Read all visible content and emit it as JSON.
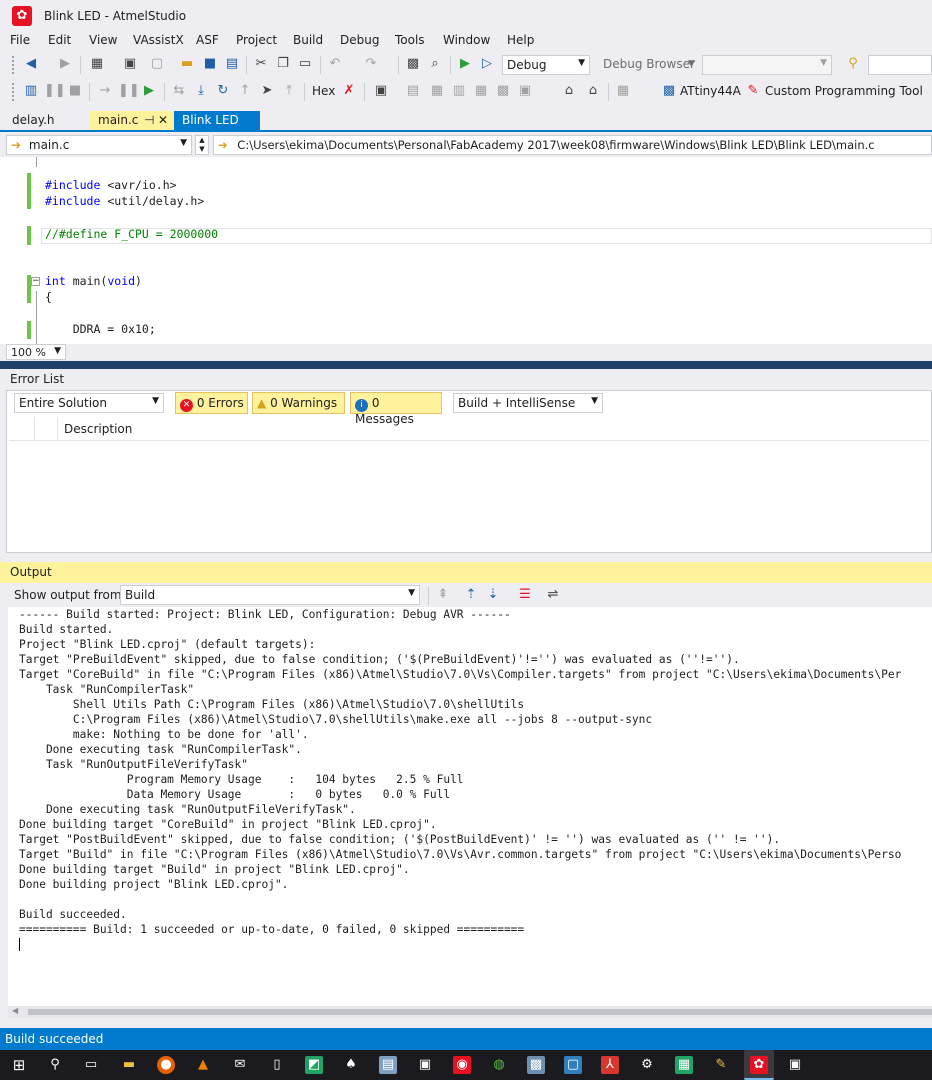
{
  "window": {
    "title": "Blink LED - AtmelStudio"
  },
  "menu": [
    "File",
    "Edit",
    "View",
    "VAssistX",
    "ASF",
    "Project",
    "Build",
    "Debug",
    "Tools",
    "Window",
    "Help"
  ],
  "toolbar1": {
    "config": "Debug",
    "debug_browser": "Debug Browser"
  },
  "toolbar2": {
    "hex": "Hex",
    "device": "ATtiny44A",
    "tool": "Custom Programming Tool"
  },
  "tabs": [
    {
      "label": "delay.h"
    },
    {
      "label": "main.c",
      "pin": "⊣",
      "close": "✕"
    },
    {
      "label": "Blink LED"
    }
  ],
  "nav": {
    "file": "main.c",
    "path": "C:\\Users\\ekima\\Documents\\Personal\\FabAcademy 2017\\week08\\firmware\\Windows\\Blink LED\\Blink LED\\main.c"
  },
  "editor": {
    "lines": [
      "#include <avr/io.h>",
      "#include <util/delay.h>",
      "//#define F_CPU = 2000000",
      "int main(void)",
      "{",
      "    DDRA = 0x10;"
    ],
    "zoom": "100 %"
  },
  "error_list": {
    "title": "Error List",
    "scope": "Entire Solution",
    "errors": "0 Errors",
    "warnings": "0 Warnings",
    "messages": "0 Messages",
    "filter": "Build + IntelliSense",
    "col_description": "Description"
  },
  "output": {
    "title": "Output",
    "show_from_label": "Show output from:",
    "source": "Build",
    "lines": [
      "------ Build started: Project: Blink LED, Configuration: Debug AVR ------",
      "Build started.",
      "Project \"Blink LED.cproj\" (default targets):",
      "Target \"PreBuildEvent\" skipped, due to false condition; ('$(PreBuildEvent)'!='') was evaluated as (''!='').",
      "Target \"CoreBuild\" in file \"C:\\Program Files (x86)\\Atmel\\Studio\\7.0\\Vs\\Compiler.targets\" from project \"C:\\Users\\ekima\\Documents\\Per",
      "    Task \"RunCompilerTask\"",
      "        Shell Utils Path C:\\Program Files (x86)\\Atmel\\Studio\\7.0\\shellUtils",
      "        C:\\Program Files (x86)\\Atmel\\Studio\\7.0\\shellUtils\\make.exe all --jobs 8 --output-sync",
      "        make: Nothing to be done for 'all'.",
      "    Done executing task \"RunCompilerTask\".",
      "    Task \"RunOutputFileVerifyTask\"",
      "                Program Memory Usage    :   104 bytes   2.5 % Full",
      "                Data Memory Usage       :   0 bytes   0.0 % Full",
      "    Done executing task \"RunOutputFileVerifyTask\".",
      "Done building target \"CoreBuild\" in project \"Blink LED.cproj\".",
      "Target \"PostBuildEvent\" skipped, due to false condition; ('$(PostBuildEvent)' != '') was evaluated as ('' != '').",
      "Target \"Build\" in file \"C:\\Program Files (x86)\\Atmel\\Studio\\7.0\\Vs\\Avr.common.targets\" from project \"C:\\Users\\ekima\\Documents\\Perso",
      "Done building target \"Build\" in project \"Blink LED.cproj\".",
      "Done building project \"Blink LED.cproj\".",
      "",
      "Build succeeded.",
      "========== Build: 1 succeeded or up-to-date, 0 failed, 0 skipped =========="
    ]
  },
  "status": {
    "text": "Build succeeded"
  },
  "colors": {
    "accent": "#007acc",
    "output_header": "#fff29d",
    "change_marker": "#6cc644"
  }
}
